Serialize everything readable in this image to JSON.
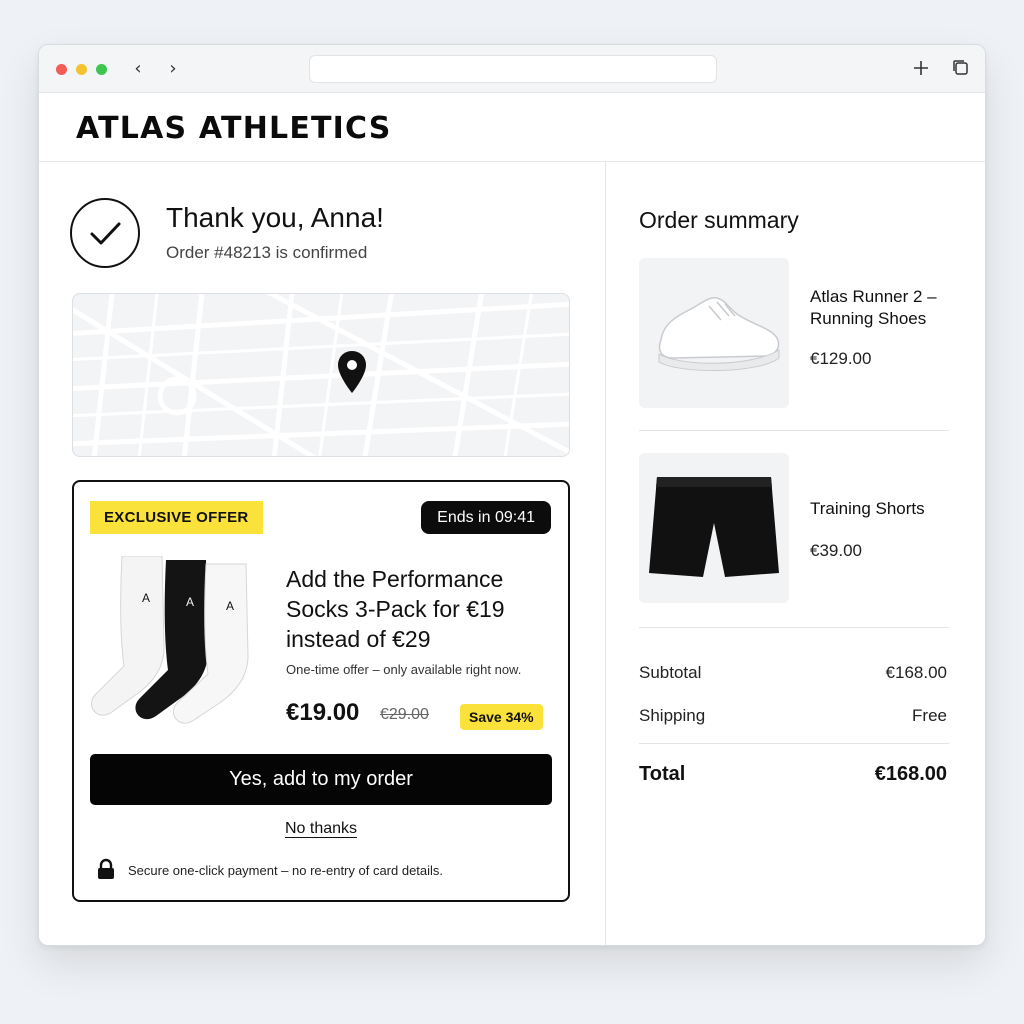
{
  "browser": {
    "url": "",
    "icons": [
      "back-icon",
      "forward-icon",
      "new-tab-icon",
      "tabs-icon"
    ]
  },
  "header": {
    "brand": "ATLAS ATHLETICS"
  },
  "confirmation": {
    "title": "Thank you, Anna!",
    "order_status": "Order #48213 is confirmed"
  },
  "offer": {
    "badge": "EXCLUSIVE OFFER",
    "timer": "Ends in 09:41",
    "title": "Add the Performance Socks 3-Pack for €19 instead of €29",
    "note": "One-time offer – only available right now.",
    "price": "€19.00",
    "old_price": "€29.00",
    "save": "Save 34%",
    "cta": "Yes, add to my order",
    "decline": "No thanks",
    "secure_note": "Secure one-click payment – no re-entry of card details.",
    "sock_logo": "A"
  },
  "summary": {
    "title": "Order summary",
    "items": [
      {
        "name": "Atlas Runner 2 – Running Shoes",
        "price": "€129.00"
      },
      {
        "name": "Training Shorts",
        "price": "€39.00"
      }
    ],
    "subtotal_label": "Subtotal",
    "subtotal": "€168.00",
    "shipping_label": "Shipping",
    "shipping": "Free",
    "total_label": "Total",
    "total": "€168.00"
  },
  "colors": {
    "accent_yellow": "#fbe23a",
    "primary_black": "#050505",
    "page_bg": "#eef1f5"
  }
}
